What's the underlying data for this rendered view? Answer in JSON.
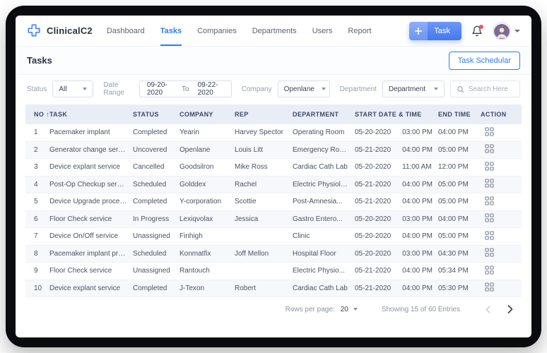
{
  "brand": {
    "name": "ClinicalC2"
  },
  "nav": {
    "items": [
      {
        "label": "Dashboard",
        "active": false
      },
      {
        "label": "Tasks",
        "active": true
      },
      {
        "label": "Companies",
        "active": false
      },
      {
        "label": "Departments",
        "active": false
      },
      {
        "label": "Users",
        "active": false
      },
      {
        "label": "Report",
        "active": false
      }
    ],
    "task_button_label": "Task"
  },
  "page": {
    "title": "Tasks",
    "scheduler_button_label": "Task Schedular"
  },
  "filters": {
    "status": {
      "label": "Status",
      "value": "All"
    },
    "date_range": {
      "label": "Date Range",
      "from": "09-20-2020",
      "to_label": "To",
      "to": "09-22-2020"
    },
    "company": {
      "label": "Company",
      "value": "Openlane"
    },
    "department": {
      "label": "Department",
      "value": "Department"
    },
    "search": {
      "placeholder": "Search Here"
    }
  },
  "table": {
    "headers": [
      "NO",
      "TASK",
      "STATUS",
      "COMPANY",
      "REP",
      "DEPARTMENT",
      "START DATE & TIME",
      "END TIME",
      "ACTION"
    ],
    "sort_arrow": "↑",
    "rows": [
      {
        "no": "1",
        "task": "Pacemaker implant",
        "status": "Completed",
        "company": "Yearin",
        "rep": "Harvey Spector",
        "department": "Operating Room",
        "start_date": "05-20-2020",
        "start_time": "03:00 PM",
        "end_time": "04:00 PM"
      },
      {
        "no": "2",
        "task": "Generator change service",
        "status": "Uncovered",
        "company": "Openlane",
        "rep": "Louis Litt",
        "department": "Emergency Room",
        "start_date": "05-21-2020",
        "start_time": "04:00 PM",
        "end_time": "05:00 PM"
      },
      {
        "no": "3",
        "task": "Device explant service",
        "status": "Cancelled",
        "company": "Goodsilron",
        "rep": "Mike Ross",
        "department": "Cardiac Cath Lab",
        "start_date": "05-20-2020",
        "start_time": "11:00 AM",
        "end_time": "12:00 PM"
      },
      {
        "no": "4",
        "task": "Post-Op Checkup service",
        "status": "Scheduled",
        "company": "Golddex",
        "rep": "Rachel",
        "department": "Electric Physiolo...",
        "start_date": "05-21-2020",
        "start_time": "04:00 PM",
        "end_time": "05:00 PM"
      },
      {
        "no": "5",
        "task": "Device Upgrade procedure",
        "status": "Completed",
        "company": "Y-corporation",
        "rep": "Scottie",
        "department": "Post-Amnesia...",
        "start_date": "05-21-2020",
        "start_time": "04:00 PM",
        "end_time": "05:00 PM"
      },
      {
        "no": "6",
        "task": "Floor Check service",
        "status": "In Progress",
        "company": "Lexiqvolax",
        "rep": "Jessica",
        "department": "Gastro Entero...",
        "start_date": "05-20-2020",
        "start_time": "03:00 PM",
        "end_time": "04:00 PM"
      },
      {
        "no": "7",
        "task": "Device On/Off service",
        "status": "Unassigned",
        "company": "Finhigh",
        "rep": "",
        "department": "Clinic",
        "start_date": "05-20-2020",
        "start_time": "04:00 PM",
        "end_time": "05:00 PM"
      },
      {
        "no": "8",
        "task": "Pacemaker implant proce...",
        "status": "Scheduled",
        "company": "Konmatfix",
        "rep": "Joff Mellon",
        "department": "Hospital Floor",
        "start_date": "05-20-2020",
        "start_time": "03:00 PM",
        "end_time": "04:30 PM"
      },
      {
        "no": "9",
        "task": "Floor Check service",
        "status": "Unassigned",
        "company": "Rantouch",
        "rep": "",
        "department": "Electric Physio...",
        "start_date": "05-21-2020",
        "start_time": "04:00 PM",
        "end_time": "05:34 PM"
      },
      {
        "no": "10",
        "task": "Device explant service",
        "status": "Completed",
        "company": "J-Texon",
        "rep": "Robert",
        "department": "Cardiac Cath Lab",
        "start_date": "05-21-2020",
        "start_time": "04:00 PM",
        "end_time": "05:30 PM"
      }
    ]
  },
  "footer": {
    "rows_per_page_label": "Rows per page:",
    "rows_per_page_value": "20",
    "showing_text": "Showing 15 of 60 Entries"
  },
  "colors": {
    "accent": "#2e7cf5",
    "table_header_bg": "#e9edf6",
    "alt_row_bg": "#f7f8fb",
    "notification_badge": "#f4516c"
  }
}
